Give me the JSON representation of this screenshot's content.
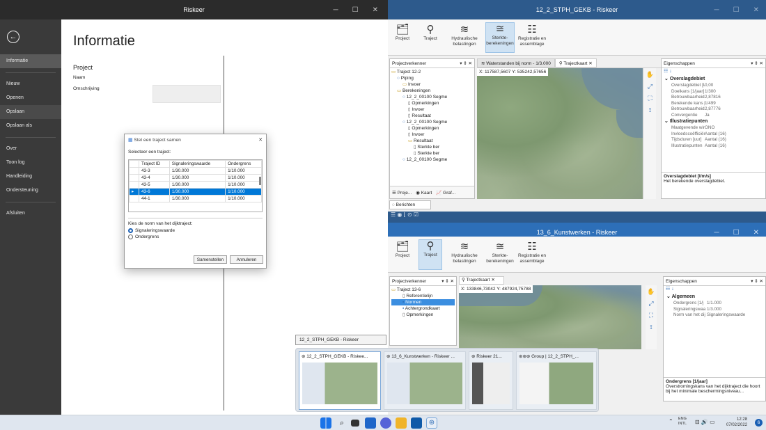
{
  "left_window": {
    "title": "Riskeer",
    "page_title": "Informatie",
    "nav": [
      "Informatie",
      "Nieuw",
      "Openen",
      "Opslaan",
      "Opslaan als",
      "Over",
      "Toon log",
      "Handleiding",
      "Ondersteuning",
      "Afsluiten"
    ],
    "project_header": "Project",
    "naam": "Naam",
    "omschrijving": "Omschrijving"
  },
  "dialog": {
    "title": "Stel een traject samen",
    "prompt": "Selecteer een traject:",
    "headers": [
      "Traject ID",
      "Signaleringswaarde",
      "Ondergrens"
    ],
    "rows": [
      [
        "43-3",
        "1/30.000",
        "1/10.000"
      ],
      [
        "43-4",
        "1/30.000",
        "1/10.000"
      ],
      [
        "43-5",
        "1/30.000",
        "1/10.000"
      ],
      [
        "43-6",
        "1/30.000",
        "1/10.000"
      ],
      [
        "44-1",
        "1/30.000",
        "1/10.000"
      ]
    ],
    "norm_label": "Kies de norm van het dijktraject:",
    "opt1": "Signaleringswaarde",
    "opt2": "Ondergrens",
    "ok": "Samenstellen",
    "cancel": "Annuleren"
  },
  "win_top": {
    "title": "12_2_STPH_GEKB - Riskeer",
    "ribbon": [
      "Project",
      "Traject",
      "Hydraulische belastingen",
      "Sterkte-berekeningen",
      "Registratie en assemblage"
    ],
    "explorer": "Projectverkenner",
    "tree": [
      "Traject 12-2",
      "Piping",
      "Invoer",
      "Berekeningen",
      "12_2_00100 Segme",
      "Opmerkingen",
      "Invoer",
      "Resultaat",
      "12_2_00100 Segme",
      "Opmerkingen",
      "Invoer",
      "Resultaat",
      "Sterkte ber",
      "Sterkte ber",
      "12_2_00100 Segme"
    ],
    "tabs": [
      "Waterstanden bij norm - 1/3.000",
      "Trajectkaart"
    ],
    "coords": "X: 117587,5607    Y: 535242,57656",
    "bottom_tabs": [
      "Proje...",
      "Kaart",
      "Graf..."
    ],
    "berichten": "Berichten",
    "props_title": "Eigenschappen",
    "cat1": "Overslagdebiet",
    "p1": [
      [
        "Overslagdebiet [l/",
        "0,00"
      ],
      [
        "Doelkans [1/jaar]",
        "1/300"
      ],
      [
        "Betrouwbaarheids",
        "2,87816"
      ],
      [
        "Berekende kans [1",
        "1/499"
      ],
      [
        "Betrouwbaarheids",
        "2,87776"
      ],
      [
        "Convergentie",
        "Ja"
      ]
    ],
    "cat2": "Illustratiepunten",
    "p2": [
      [
        "Maatgevende win",
        "ONO"
      ],
      [
        "Invloedscoëfficiën",
        "Aantal (16)"
      ],
      [
        "Tijdsduren [uur]",
        "Aantal (16)"
      ],
      [
        "Illustratiepunten",
        "Aantal (16)"
      ]
    ],
    "desc_title": "Overslagdebiet [l/m/s]",
    "desc": "Het berekende overslagdebiet."
  },
  "win_bot": {
    "title": "13_6_Kunstwerken - Riskeer",
    "explorer": "Projectverkenner",
    "tree": [
      "Traject 13-6",
      "Referentielijn",
      "Normen",
      "Achtergrondkaart",
      "Opmerkingen"
    ],
    "tab": "Trajectkaart",
    "coords": "X: 133846,73042    Y: 487924,75788",
    "props_title": "Eigenschappen",
    "cat": "Algemeen",
    "p": [
      [
        "Ondergrens [1/j",
        "1/1.000"
      ],
      [
        "Signaleringswaa",
        "1/3.000"
      ],
      [
        "Norm van het dij",
        "Signaleringswaarde"
      ]
    ],
    "desc_title": "Ondergrens [1/jaar]",
    "desc": "Overstromingskans van het dijktraject die hoort bij het minimale beschermingsniveau..."
  },
  "tooltip": "12_2_STPH_GEKB - Riskeer",
  "thumbs": [
    "12_2_STPH_GEKB - Riskee...",
    "13_6_Kunstwerken - Riskeer ...",
    "Riskeer 21...",
    "Group | 12_2_STPH_..."
  ],
  "tray": {
    "lang": "ENG",
    "lang2": "INTL",
    "time": "12:28",
    "date": "07/02/2022",
    "badge": "6"
  }
}
